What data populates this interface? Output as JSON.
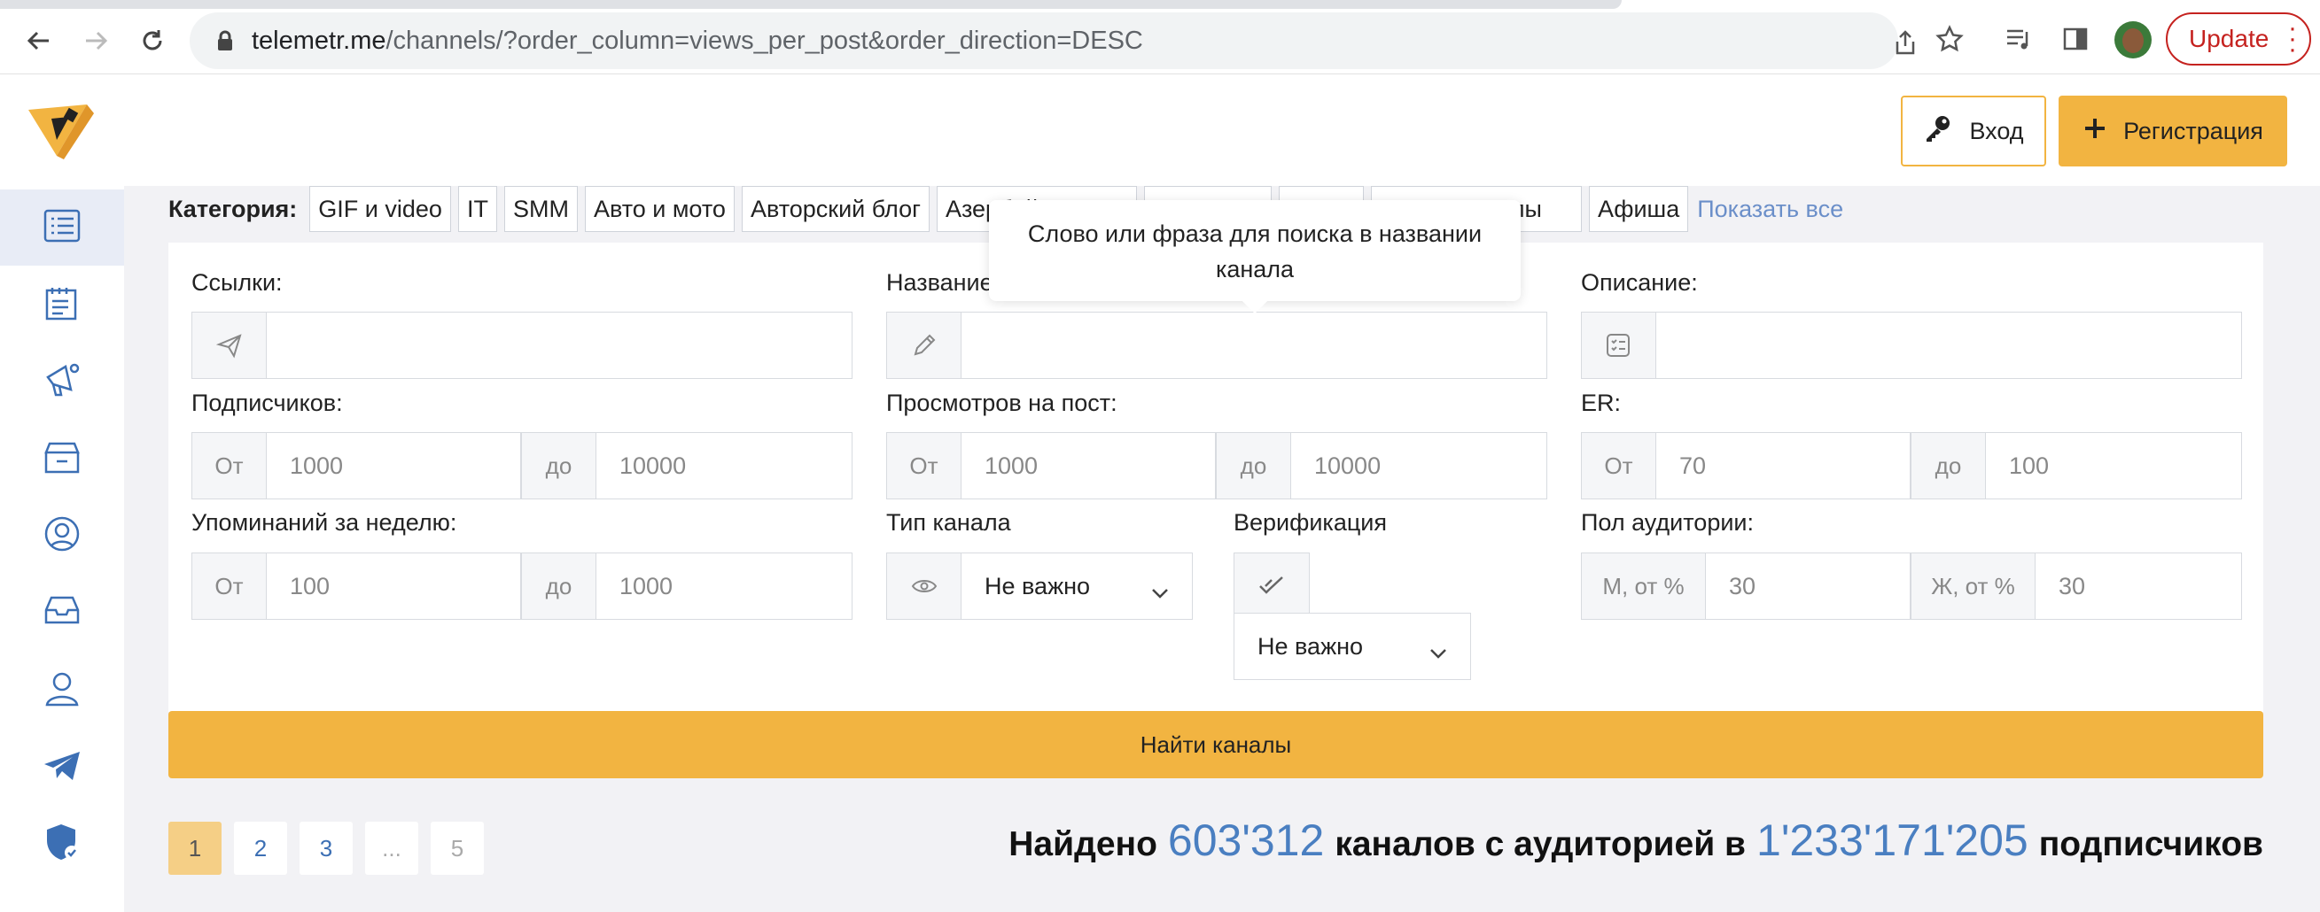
{
  "browser": {
    "url_host": "telemetr.me",
    "url_path": "/channels/?order_column=views_per_post&order_direction=DESC",
    "update_label": "Update"
  },
  "header": {
    "login_label": "Вход",
    "register_label": "Регистрация"
  },
  "categories": {
    "label": "Категория:",
    "chips": [
      "GIF и video",
      "IT",
      "SMM",
      "Авто и мото",
      "Авторский блог",
      "Азербай",
      "кие каналы",
      "Афиша"
    ],
    "show_all": "Показать все"
  },
  "tooltip": {
    "text": "Слово или фраза для поиска в названии канала"
  },
  "filters": {
    "links_label": "Ссылки:",
    "name_label": "Название",
    "description_label": "Описание:",
    "subscribers_label": "Подписчиков:",
    "views_label": "Просмотров на пост:",
    "er_label": "ER:",
    "mentions_label": "Упоминаний за неделю:",
    "channel_type_label": "Тип канала",
    "verification_label": "Верификация",
    "audience_gender_label": "Пол аудитории:",
    "from": "От",
    "to": "до",
    "subscribers_from": "1000",
    "subscribers_to": "10000",
    "views_from": "1000",
    "views_to": "10000",
    "er_from": "70",
    "er_to": "100",
    "mentions_from": "100",
    "mentions_to": "1000",
    "channel_type_value": "Не важно",
    "verification_value": "Не важно",
    "male_label": "М, от %",
    "male_value": "30",
    "female_label": "Ж, от %",
    "female_value": "30"
  },
  "find_button": "Найти каналы",
  "pagination": [
    "1",
    "2",
    "3",
    "...",
    "5"
  ],
  "result": {
    "prefix": "Найдено",
    "channels": "603'312",
    "middle": "каналов с аудиторией в",
    "subscribers": "1'233'171'205",
    "suffix": "подписчиков"
  },
  "colors": {
    "accent": "#f2b441",
    "link": "#4a7fc1",
    "sidebar_icon": "#3c6fb4"
  }
}
